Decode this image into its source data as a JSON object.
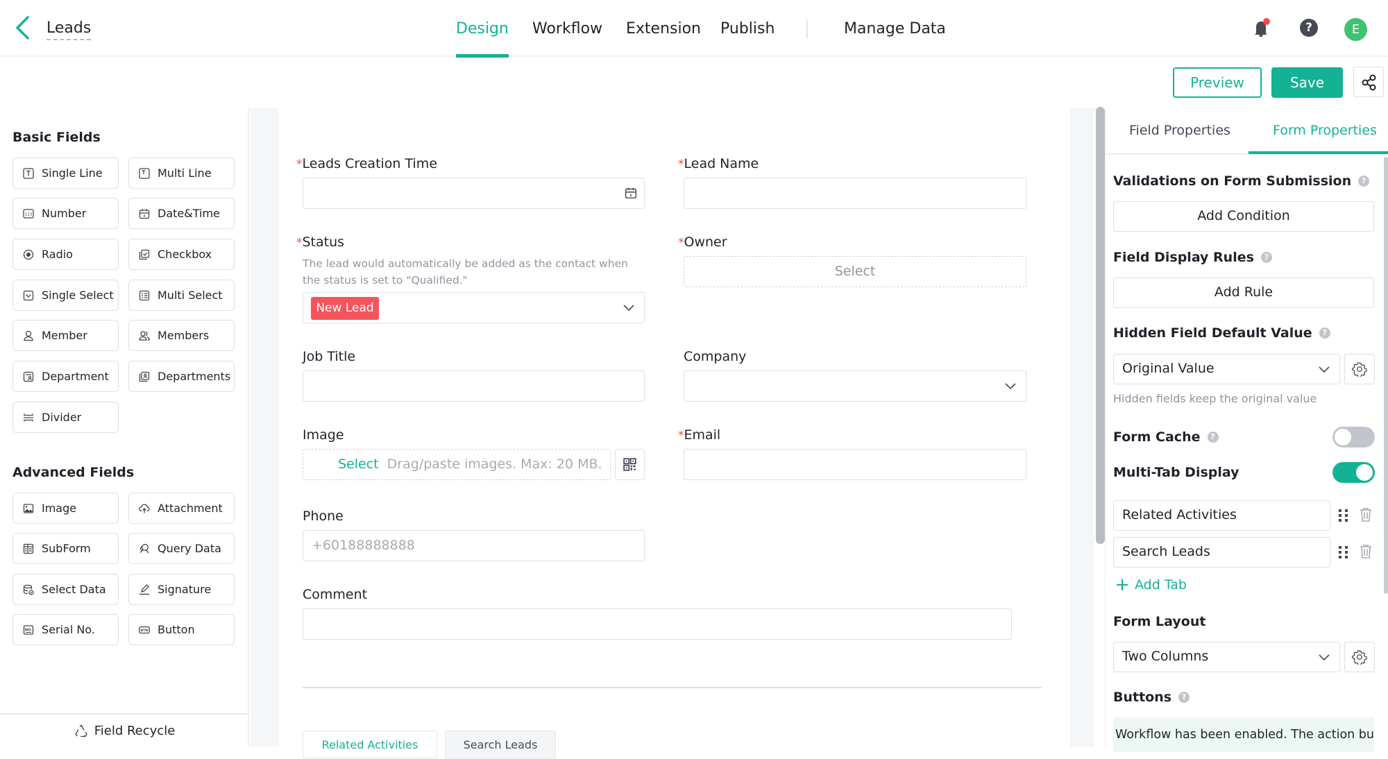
{
  "header": {
    "title": "Leads",
    "nav_tabs": [
      {
        "label": "Design",
        "active": true
      },
      {
        "label": "Workflow",
        "active": false
      },
      {
        "label": "Extension",
        "active": false
      },
      {
        "label": "Publish",
        "active": false
      },
      {
        "label": "Manage Data",
        "active": false
      }
    ],
    "avatar_initial": "E",
    "help_glyph": "?",
    "notification_dot": true,
    "icons": [
      "back-chevron-icon",
      "bell-icon",
      "help-icon",
      "share-icon"
    ]
  },
  "toolbar": {
    "preview_label": "Preview",
    "save_label": "Save"
  },
  "left_panel": {
    "basic_title": "Basic Fields",
    "basic_fields": [
      {
        "label": "Single Line",
        "icon": "text-box-icon"
      },
      {
        "label": "Multi Line",
        "icon": "text-box-icon"
      },
      {
        "label": "Number",
        "icon": "number-icon"
      },
      {
        "label": "Date&Time",
        "icon": "calendar-icon"
      },
      {
        "label": "Radio",
        "icon": "radio-icon"
      },
      {
        "label": "Checkbox",
        "icon": "checkbox-icon"
      },
      {
        "label": "Single Select",
        "icon": "single-select-icon"
      },
      {
        "label": "Multi Select",
        "icon": "multi-select-icon"
      },
      {
        "label": "Member",
        "icon": "user-icon"
      },
      {
        "label": "Members",
        "icon": "users-icon"
      },
      {
        "label": "Department",
        "icon": "department-icon"
      },
      {
        "label": "Departments",
        "icon": "departments-icon"
      },
      {
        "label": "Divider",
        "icon": "divider-icon"
      }
    ],
    "advanced_title": "Advanced Fields",
    "advanced_fields": [
      {
        "label": "Image",
        "icon": "image-icon"
      },
      {
        "label": "Attachment",
        "icon": "upload-cloud-icon"
      },
      {
        "label": "SubForm",
        "icon": "subform-icon"
      },
      {
        "label": "Query Data",
        "icon": "query-icon"
      },
      {
        "label": "Select Data",
        "icon": "database-icon"
      },
      {
        "label": "Signature",
        "icon": "pen-icon"
      },
      {
        "label": "Serial No.",
        "icon": "serial-icon"
      },
      {
        "label": "Button",
        "icon": "button-icon"
      }
    ],
    "recycle_label": "Field Recycle"
  },
  "form": {
    "fields": {
      "creation_time": {
        "label": "Leads Creation Time",
        "required": true,
        "value": ""
      },
      "lead_name": {
        "label": "Lead Name",
        "required": true,
        "value": ""
      },
      "status": {
        "label": "Status",
        "required": true,
        "hint": "The lead would automatically be added as the contact when the status is set to \"Qualified.\"",
        "value": "New Lead",
        "tag_color": "#f5545a"
      },
      "owner": {
        "label": "Owner",
        "required": true,
        "placeholder": "Select"
      },
      "job_title": {
        "label": "Job Title",
        "required": false,
        "value": ""
      },
      "company": {
        "label": "Company",
        "required": false,
        "value": ""
      },
      "image": {
        "label": "Image",
        "required": false,
        "select_label": "Select",
        "hint": "Drag/paste images. Max: 20 MB."
      },
      "email": {
        "label": "Email",
        "required": true,
        "value": ""
      },
      "phone": {
        "label": "Phone",
        "required": false,
        "placeholder": "+60188888888"
      },
      "comment": {
        "label": "Comment",
        "required": false,
        "value": ""
      }
    },
    "bottom_tabs": [
      {
        "label": "Related Activities",
        "active": true
      },
      {
        "label": "Search Leads",
        "active": false
      }
    ]
  },
  "right_panel": {
    "tabs": [
      {
        "label": "Field Properties",
        "active": false
      },
      {
        "label": "Form Properties",
        "active": true
      }
    ],
    "validations_title": "Validations on Form Submission",
    "add_condition_label": "Add Condition",
    "display_rules_title": "Field Display Rules",
    "add_rule_label": "Add Rule",
    "hidden_default_title": "Hidden Field Default Value",
    "hidden_default_value": "Original Value",
    "hidden_default_hint": "Hidden fields keep the original value",
    "form_cache_title": "Form Cache",
    "form_cache_enabled": false,
    "multitab_title": "Multi-Tab Display",
    "multitab_enabled": true,
    "tabs_list": [
      "Related Activities",
      "Search Leads"
    ],
    "add_tab_label": "Add Tab",
    "layout_title": "Form Layout",
    "layout_value": "Two Columns",
    "buttons_title": "Buttons",
    "workflow_note": "Workflow has been enabled. The action button"
  },
  "colors": {
    "accent": "#14b294",
    "required": "#f54a45",
    "toggle_off": "#c2c5cb",
    "avatar": "#3fc36e",
    "notification": "#f54a45"
  }
}
